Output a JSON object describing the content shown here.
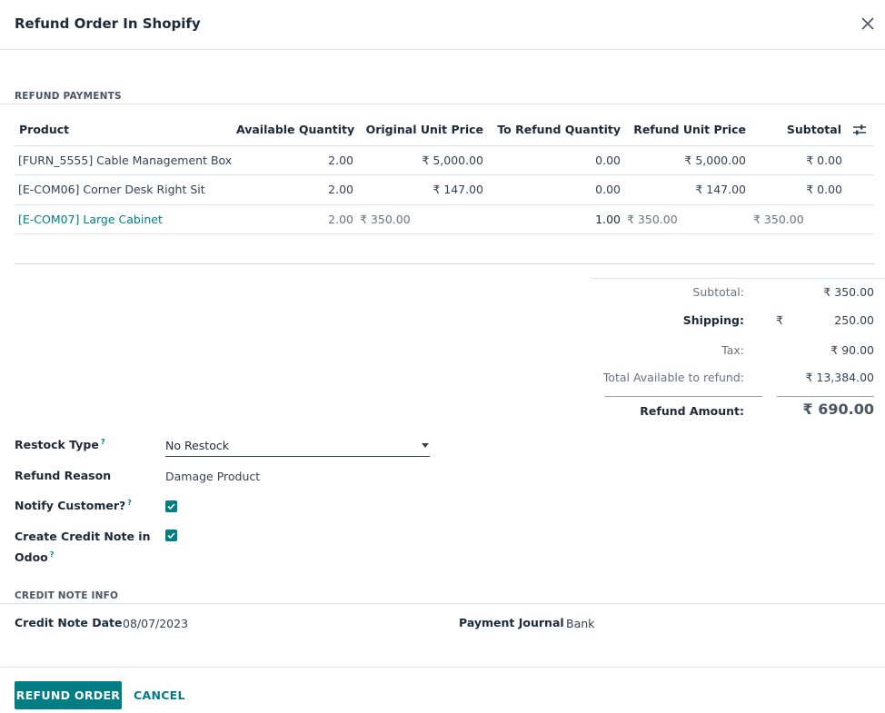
{
  "dialog": {
    "title": "Refund Order In Shopify"
  },
  "refund_payments": {
    "section_title": "REFUND PAYMENTS",
    "columns": [
      "Product",
      "Available Quantity",
      "Original Unit Price",
      "To Refund Quantity",
      "Refund Unit Price",
      "Subtotal"
    ],
    "rows": [
      {
        "product": "[FURN_5555] Cable Management Box",
        "available": "2.00",
        "orig_price": "₹ 5,000.00",
        "to_refund": "0.00",
        "refund_price": "₹ 5,000.00",
        "subtotal": "₹ 0.00"
      },
      {
        "product": "[E-COM06] Corner Desk Right Sit",
        "available": "2.00",
        "orig_price": "₹ 147.00",
        "to_refund": "0.00",
        "refund_price": "₹ 147.00",
        "subtotal": "₹ 0.00"
      },
      {
        "product": "[E-COM07] Large Cabinet",
        "available": "2.00",
        "orig_price": "₹ 350.00",
        "to_refund": "1.00",
        "refund_price": "₹ 350.00",
        "subtotal": "₹ 350.00"
      }
    ]
  },
  "summary": {
    "subtotal_label": "Subtotal:",
    "subtotal": "₹ 350.00",
    "shipping_label": "Shipping:",
    "shipping_currency": "₹",
    "shipping": "250.00",
    "tax_label": "Tax:",
    "tax": "₹ 90.00",
    "available_label": "Total Available to refund:",
    "available": "₹ 13,384.00",
    "refund_amount_label": "Refund Amount:",
    "refund_amount": "₹ 690.00"
  },
  "form": {
    "restock_type_label": "Restock Type",
    "restock_type": "No Restock",
    "help_mark": "?",
    "refund_reason_label": "Refund Reason",
    "refund_reason": "Damage Product",
    "notify_label": "Notify Customer?",
    "notify_checked": true,
    "credit_note_label_1": "Create Credit Note in",
    "credit_note_label_2": "Odoo",
    "credit_note_checked": true
  },
  "credit_note_info": {
    "section_title": "CREDIT NOTE INFO",
    "date_label": "Credit Note Date",
    "date": "08/07/2023",
    "journal_label": "Payment Journal",
    "journal": "Bank"
  },
  "footer": {
    "primary": "REFUND ORDER",
    "secondary": "CANCEL"
  },
  "colors": {
    "accent": "#017e84"
  }
}
